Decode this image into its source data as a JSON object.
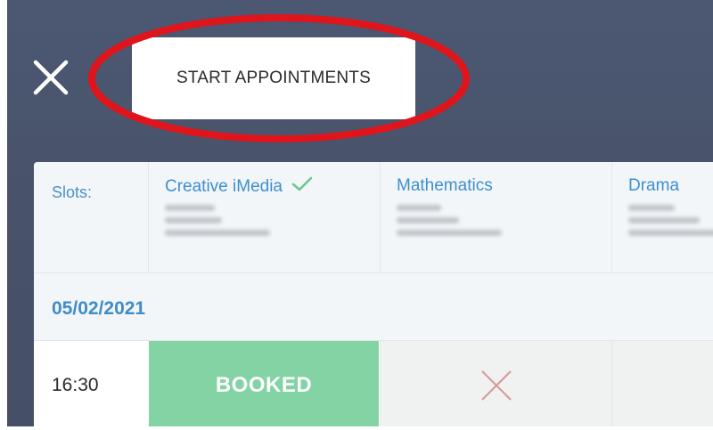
{
  "header": {
    "start_button_label": "START APPOINTMENTS"
  },
  "slots": {
    "label": "Slots:",
    "subjects": [
      {
        "name": "Creative iMedia",
        "checked": true
      },
      {
        "name": "Mathematics",
        "checked": false
      },
      {
        "name": "Drama",
        "checked": false
      }
    ]
  },
  "schedule": {
    "date": "05/02/2021",
    "rows": [
      {
        "time": "16:30",
        "cells": [
          {
            "status": "booked",
            "label": "BOOKED"
          },
          {
            "status": "unavailable"
          },
          {
            "status": "unavailable"
          }
        ]
      }
    ]
  },
  "colors": {
    "background": "#4a5570",
    "accent_blue": "#3d8fcf",
    "booked_green": "#84d3a4",
    "check_green": "#6cc58f",
    "unavailable_cross": "#d79a98",
    "highlight_red": "#e0141b"
  },
  "icons": {
    "close": "close-icon",
    "check": "check-icon",
    "unavailable": "cross-icon"
  }
}
